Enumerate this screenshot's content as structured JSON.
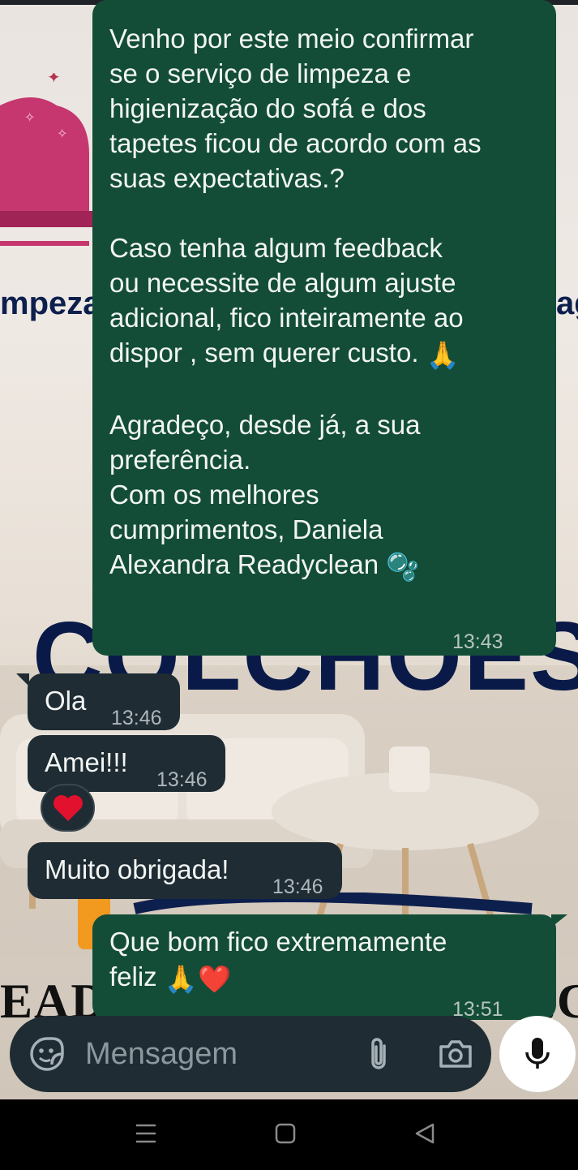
{
  "messages": [
    {
      "direction": "outgoing",
      "text": "Venho por este meio confirmar\nse o serviço de limpeza e\nhigienização do sofá e dos\ntapetes ficou de acordo com as\nsuas expectativas.?\n\nCaso tenha algum feedback\nou necessite de algum ajuste\nadicional, fico inteiramente ao\ndispor , sem querer custo.",
      "emoji_after_para2": "🙏",
      "text2": "Agradeço, desde já, a sua\npreferência.\nCom os melhores\ncumprimentos, Daniela\nAlexandra Readyclean",
      "emoji_end": "🫧",
      "time": "13:43",
      "status": "read"
    },
    {
      "direction": "incoming",
      "text": "Ola",
      "time": "13:46"
    },
    {
      "direction": "incoming",
      "text": "Amei!!!",
      "time": "13:46",
      "reaction": "❤️"
    },
    {
      "direction": "incoming",
      "text": "Muito obrigada!",
      "time": "13:46"
    },
    {
      "direction": "outgoing",
      "text": "Que bom fico extremamente\nfeliz",
      "emojis": "🙏❤️",
      "time": "13:51",
      "status": "read"
    }
  ],
  "wallpaper": {
    "word_left": "mpeza",
    "word_right": "ag",
    "big_word": "COLCHOES",
    "bottom_text": "EADYCLEAN&GMAIL.CO"
  },
  "composer": {
    "placeholder": "Mensagem",
    "icons": [
      "sticker-icon",
      "paperclip-icon",
      "camera-icon",
      "microphone-icon"
    ]
  },
  "navigation": {
    "icons": [
      "recent-apps-icon",
      "home-icon",
      "back-icon"
    ]
  },
  "colors": {
    "outgoing_bubble": "#134d37",
    "incoming_bubble": "#1f2c33",
    "composer_bg": "#1f2c33"
  }
}
